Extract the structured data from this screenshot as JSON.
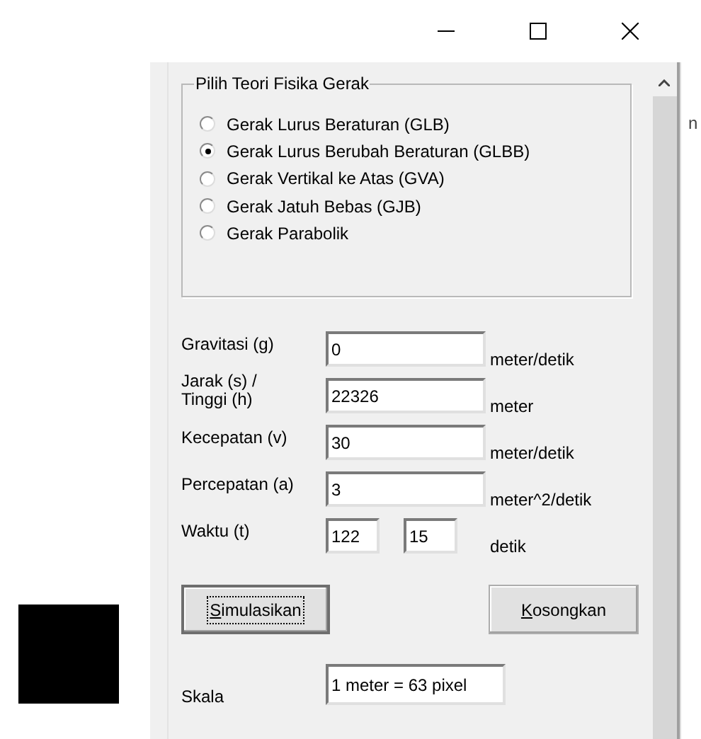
{
  "group": {
    "title": "Pilih Teori Fisika Gerak",
    "options": [
      {
        "label": "Gerak Lurus Beraturan (GLB)",
        "selected": false
      },
      {
        "label": "Gerak Lurus Berubah Beraturan (GLBB)",
        "selected": true
      },
      {
        "label": "Gerak Vertikal ke Atas (GVA)",
        "selected": false
      },
      {
        "label": "Gerak Jatuh Bebas (GJB)",
        "selected": false
      },
      {
        "label": "Gerak Parabolik",
        "selected": false
      }
    ]
  },
  "fields": [
    {
      "label": "Gravitasi (g)",
      "values": [
        "0"
      ],
      "unit": "meter/detik"
    },
    {
      "label": "Jarak (s) /\nTinggi (h)",
      "values": [
        "22326"
      ],
      "unit": "meter"
    },
    {
      "label": "Kecepatan (v)",
      "values": [
        "30"
      ],
      "unit": "meter/detik"
    },
    {
      "label": "Percepatan (a)",
      "values": [
        "3"
      ],
      "unit": "meter^2/detik"
    },
    {
      "label": "Waktu (t)",
      "values": [
        "122",
        "15"
      ],
      "unit": "detik"
    }
  ],
  "buttons": [
    {
      "label": "Simulasikan",
      "first_letter_underlined": true,
      "focused": true
    },
    {
      "label": "Kosongkan",
      "first_letter_underlined": true,
      "focused": false
    }
  ],
  "scale": {
    "label": "Skala",
    "value": "1 meter = 63 pixel"
  },
  "side_text": "n"
}
